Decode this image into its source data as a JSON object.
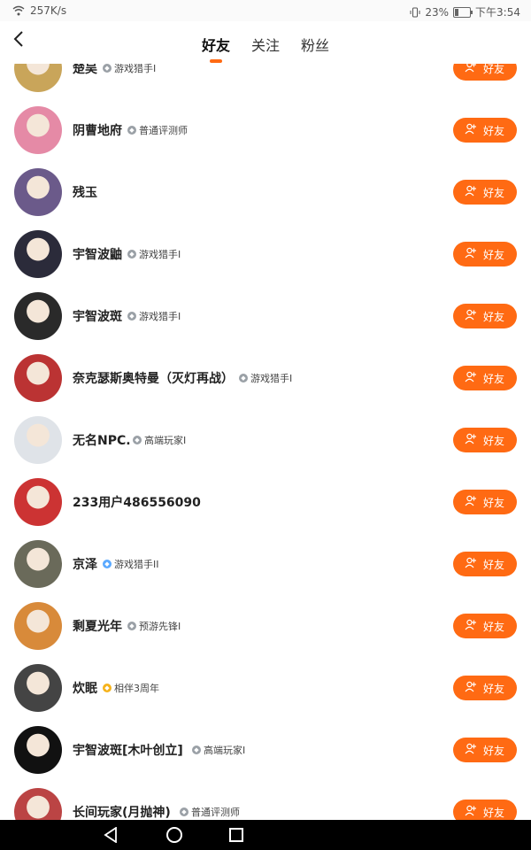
{
  "status_bar": {
    "speed": "257K/s",
    "battery": "23%",
    "time": "下午3:54",
    "battery_level": 0.23
  },
  "header": {
    "back_icon": "back-arrow-icon",
    "tabs": [
      {
        "label": "好友",
        "active": true
      },
      {
        "label": "关注"
      },
      {
        "label": "粉丝"
      }
    ],
    "accent_color": "#ff6a13"
  },
  "friend_button_label": "好友",
  "friends": [
    {
      "name": "楚吴",
      "badge": "游戏猎手I",
      "badge_color": "gray"
    },
    {
      "name": "阴曹地府",
      "badge": "普通评测师",
      "badge_color": "gray"
    },
    {
      "name": "残玉",
      "badge": ""
    },
    {
      "name": "宇智波鼬",
      "badge": "游戏猎手I",
      "badge_color": "gray"
    },
    {
      "name": "宇智波斑",
      "badge": "游戏猎手I",
      "badge_color": "gray"
    },
    {
      "name": "奈克瑟斯奥特曼（灭灯再战）",
      "badge": "游戏猎手I",
      "badge_color": "gray"
    },
    {
      "name": "无名NPC.",
      "badge": "高端玩家I",
      "badge_color": "gray"
    },
    {
      "name": "233用户486556090",
      "badge": ""
    },
    {
      "name": "京泽",
      "badge": "游戏猎手II",
      "badge_color": "blue"
    },
    {
      "name": "剩夏光年",
      "badge": "预游先锋I",
      "badge_color": "gray"
    },
    {
      "name": "炊眠",
      "badge": "相伴3周年",
      "badge_color": "gold"
    },
    {
      "name": "宇智波斑[木叶创立]",
      "badge": "高端玩家I",
      "badge_color": "gray"
    },
    {
      "name": "长间玩家(月抛神)",
      "badge": "普通评测师",
      "badge_color": "gray"
    }
  ]
}
